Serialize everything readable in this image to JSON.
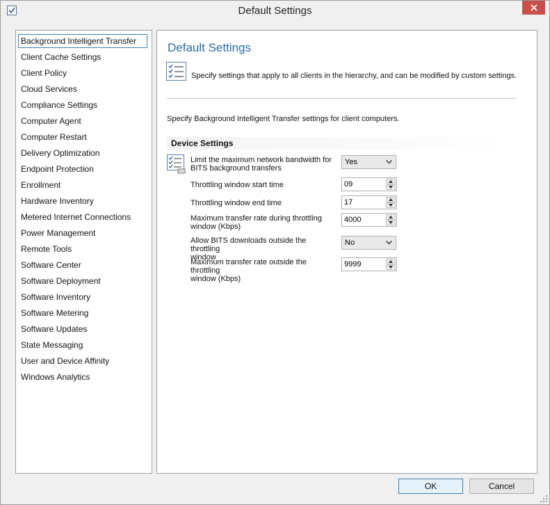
{
  "window": {
    "title": "Default Settings"
  },
  "nav": {
    "items": [
      "Background Intelligent Transfer",
      "Client Cache Settings",
      "Client Policy",
      "Cloud Services",
      "Compliance Settings",
      "Computer Agent",
      "Computer Restart",
      "Delivery Optimization",
      "Endpoint Protection",
      "Enrollment",
      "Hardware Inventory",
      "Metered Internet Connections",
      "Power Management",
      "Remote Tools",
      "Software Center",
      "Software Deployment",
      "Software Inventory",
      "Software Metering",
      "Software Updates",
      "State Messaging",
      "User and Device Affinity",
      "Windows Analytics"
    ],
    "selected": "Background Intelligent Transfer"
  },
  "main": {
    "title": "Default Settings",
    "intro": "Specify settings that apply to all clients in the hierarchy, and can be modified by custom settings.",
    "section_desc": "Specify Background Intelligent Transfer settings for client computers.",
    "group_title": "Device Settings",
    "settings": [
      {
        "label_line1": "Limit the maximum network bandwidth for",
        "label_line2": "BITS background transfers",
        "control": "dropdown",
        "value": "Yes"
      },
      {
        "label_line1": "Throttling window start time",
        "label_line2": "",
        "control": "spinner",
        "value": "09"
      },
      {
        "label_line1": "Throttling window end time",
        "label_line2": "",
        "control": "spinner",
        "value": "17"
      },
      {
        "label_line1": "Maximum transfer rate during throttling",
        "label_line2": "window (Kbps)",
        "control": "spinner",
        "value": "4000"
      },
      {
        "label_line1": "Allow BITS downloads outside the throttling",
        "label_line2": "window",
        "control": "dropdown",
        "value": "No"
      },
      {
        "label_line1": "Maximum transfer rate outside the throttling",
        "label_line2": "window (Kbps)",
        "control": "spinner",
        "value": "9999"
      }
    ]
  },
  "buttons": {
    "ok": "OK",
    "cancel": "Cancel"
  },
  "colors": {
    "accent_title": "#2b6aa0",
    "selection_border": "#3c7fb1",
    "close_button": "#c7504b"
  },
  "icons": {
    "title": "checklist-icon",
    "close": "close-icon",
    "intro": "checklist-icon",
    "settings": "settings-checklist-icon",
    "dropdown": "chevron-down-icon",
    "spin_up": "chevron-up-icon",
    "spin_down": "chevron-down-icon"
  }
}
